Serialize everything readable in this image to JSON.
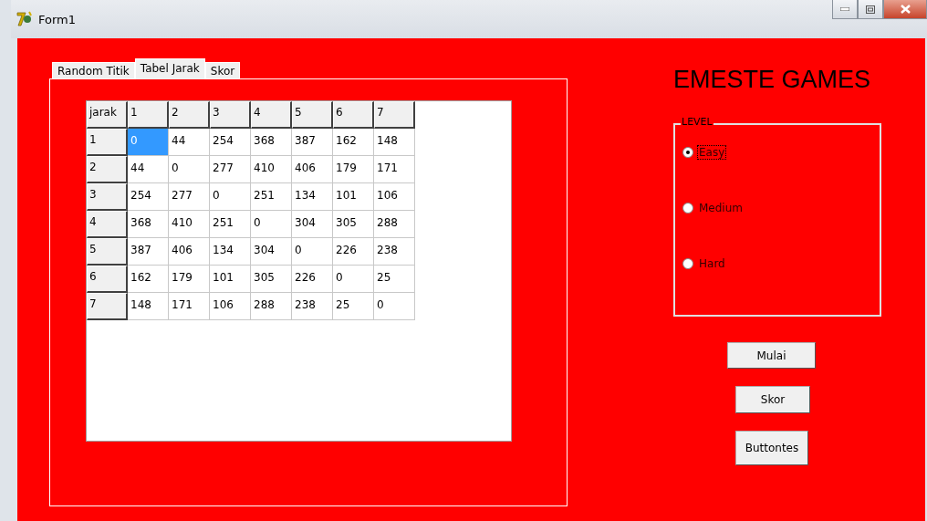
{
  "window": {
    "title": "Form1"
  },
  "tabs": [
    {
      "label": "Random Titik",
      "selected": false
    },
    {
      "label": "Tabel Jarak",
      "selected": true
    },
    {
      "label": "Skor",
      "selected": false
    }
  ],
  "table": {
    "columns": [
      "jarak",
      "1",
      "2",
      "3",
      "4",
      "5",
      "6",
      "7"
    ],
    "rows": [
      {
        "cells": [
          {
            "kind": "header",
            "value": "1",
            "selected": false
          },
          {
            "kind": "data",
            "value": "0",
            "selected": true
          },
          {
            "kind": "data",
            "value": "44",
            "selected": false
          },
          {
            "kind": "data",
            "value": "254",
            "selected": false
          },
          {
            "kind": "data",
            "value": "368",
            "selected": false
          },
          {
            "kind": "data",
            "value": "387",
            "selected": false
          },
          {
            "kind": "data",
            "value": "162",
            "selected": false
          },
          {
            "kind": "data",
            "value": "148",
            "selected": false
          }
        ]
      },
      {
        "cells": [
          {
            "kind": "header",
            "value": "2",
            "selected": false
          },
          {
            "kind": "data",
            "value": "44",
            "selected": false
          },
          {
            "kind": "data",
            "value": "0",
            "selected": false
          },
          {
            "kind": "data",
            "value": "277",
            "selected": false
          },
          {
            "kind": "data",
            "value": "410",
            "selected": false
          },
          {
            "kind": "data",
            "value": "406",
            "selected": false
          },
          {
            "kind": "data",
            "value": "179",
            "selected": false
          },
          {
            "kind": "data",
            "value": "171",
            "selected": false
          }
        ]
      },
      {
        "cells": [
          {
            "kind": "header",
            "value": "3",
            "selected": false
          },
          {
            "kind": "data",
            "value": "254",
            "selected": false
          },
          {
            "kind": "data",
            "value": "277",
            "selected": false
          },
          {
            "kind": "data",
            "value": "0",
            "selected": false
          },
          {
            "kind": "data",
            "value": "251",
            "selected": false
          },
          {
            "kind": "data",
            "value": "134",
            "selected": false
          },
          {
            "kind": "data",
            "value": "101",
            "selected": false
          },
          {
            "kind": "data",
            "value": "106",
            "selected": false
          }
        ]
      },
      {
        "cells": [
          {
            "kind": "header",
            "value": "4",
            "selected": false
          },
          {
            "kind": "data",
            "value": "368",
            "selected": false
          },
          {
            "kind": "data",
            "value": "410",
            "selected": false
          },
          {
            "kind": "data",
            "value": "251",
            "selected": false
          },
          {
            "kind": "data",
            "value": "0",
            "selected": false
          },
          {
            "kind": "data",
            "value": "304",
            "selected": false
          },
          {
            "kind": "data",
            "value": "305",
            "selected": false
          },
          {
            "kind": "data",
            "value": "288",
            "selected": false
          }
        ]
      },
      {
        "cells": [
          {
            "kind": "header",
            "value": "5",
            "selected": false
          },
          {
            "kind": "data",
            "value": "387",
            "selected": false
          },
          {
            "kind": "data",
            "value": "406",
            "selected": false
          },
          {
            "kind": "data",
            "value": "134",
            "selected": false
          },
          {
            "kind": "data",
            "value": "304",
            "selected": false
          },
          {
            "kind": "data",
            "value": "0",
            "selected": false
          },
          {
            "kind": "data",
            "value": "226",
            "selected": false
          },
          {
            "kind": "data",
            "value": "238",
            "selected": false
          }
        ]
      },
      {
        "cells": [
          {
            "kind": "header",
            "value": "6",
            "selected": false
          },
          {
            "kind": "data",
            "value": "162",
            "selected": false
          },
          {
            "kind": "data",
            "value": "179",
            "selected": false
          },
          {
            "kind": "data",
            "value": "101",
            "selected": false
          },
          {
            "kind": "data",
            "value": "305",
            "selected": false
          },
          {
            "kind": "data",
            "value": "226",
            "selected": false
          },
          {
            "kind": "data",
            "value": "0",
            "selected": false
          },
          {
            "kind": "data",
            "value": "25",
            "selected": false
          }
        ]
      },
      {
        "cells": [
          {
            "kind": "header",
            "value": "7",
            "selected": false
          },
          {
            "kind": "data",
            "value": "148",
            "selected": false
          },
          {
            "kind": "data",
            "value": "171",
            "selected": false
          },
          {
            "kind": "data",
            "value": "106",
            "selected": false
          },
          {
            "kind": "data",
            "value": "288",
            "selected": false
          },
          {
            "kind": "data",
            "value": "238",
            "selected": false
          },
          {
            "kind": "data",
            "value": "25",
            "selected": false
          },
          {
            "kind": "data",
            "value": "0",
            "selected": false
          }
        ]
      }
    ]
  },
  "heading": "EMESTE GAMES",
  "level_group": {
    "label": "LEVEL",
    "options": [
      {
        "label": "Easy",
        "selected": true,
        "focused": true
      },
      {
        "label": "Medium",
        "selected": false,
        "focused": false
      },
      {
        "label": "Hard",
        "selected": false,
        "focused": false
      }
    ]
  },
  "buttons": [
    "Mulai",
    "Skor",
    "Buttontes"
  ]
}
